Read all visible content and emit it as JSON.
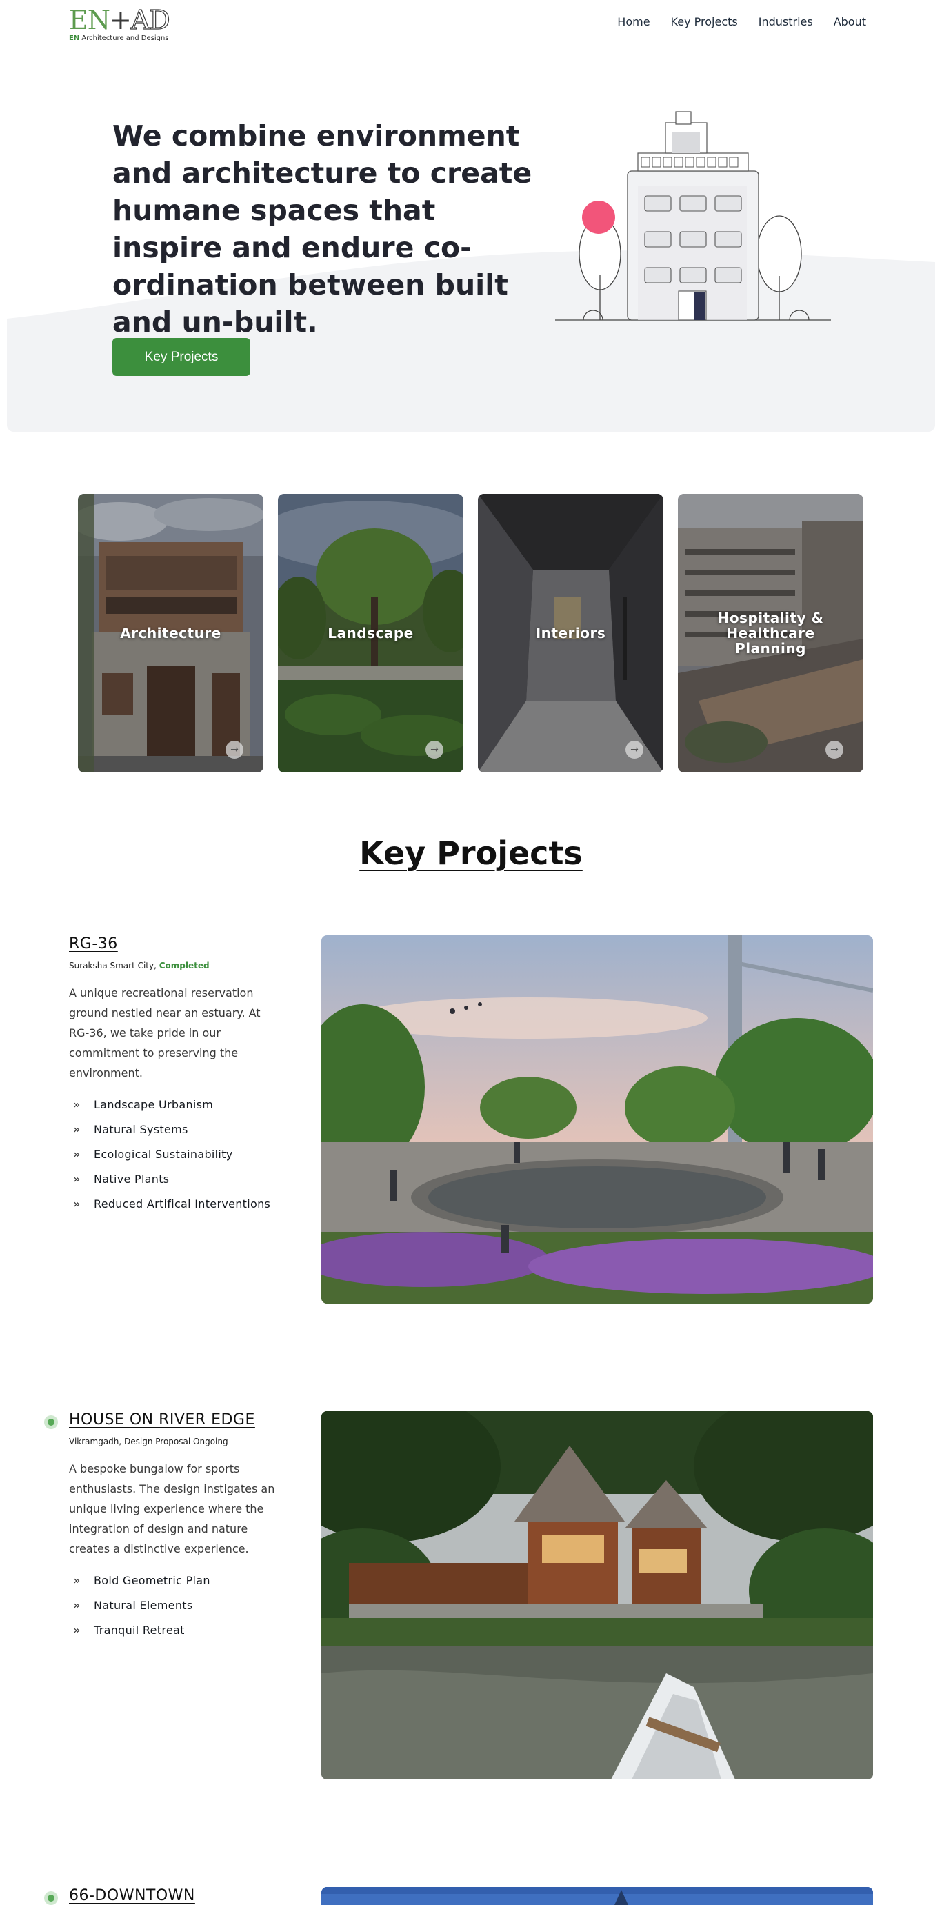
{
  "nav": {
    "logo_mark_en": "EN",
    "logo_mark_plus": "+",
    "logo_mark_ad": "AD",
    "logo_sub_en": "EN",
    "logo_sub_rest": " Architecture and Designs",
    "links": [
      "Home",
      "Key Projects",
      "Industries",
      "About"
    ]
  },
  "hero": {
    "headline": "We combine environment and architecture to create humane spaces that inspire and endure co-ordination between built and un-built.",
    "cta_label": "Key Projects"
  },
  "categories": [
    {
      "label": "Architecture",
      "icon": "arrow-right-icon"
    },
    {
      "label": "Landscape",
      "icon": "arrow-right-icon"
    },
    {
      "label": "Interiors",
      "icon": "arrow-right-icon"
    },
    {
      "label": "Hospitality & Healthcare Planning",
      "icon": "arrow-right-icon"
    }
  ],
  "key_projects": {
    "title": "Key Projects",
    "projects": [
      {
        "name": "RG-36",
        "location": "Suraksha Smart City, ",
        "status": "Completed",
        "description": "A unique recreational reservation ground nestled near an estuary. At RG-36, we take pride in our commitment to preserving the environment.",
        "tags": [
          "Landscape Urbanism",
          "Natural Systems",
          "Ecological Sustainability",
          "Native Plants",
          "Reduced Artifical Interventions"
        ]
      },
      {
        "name": "HOUSE ON RIVER EDGE",
        "location": "Vikramgadh, Design Proposal Ongoing",
        "status": "",
        "description": "A bespoke bungalow for sports enthusiasts. The design instigates an unique living experience where the integration of design and nature creates a distinctive experience.",
        "tags": [
          "Bold Geometric Plan",
          "Natural Elements",
          "Tranquil Retreat"
        ]
      },
      {
        "name": "66-DOWNTOWN",
        "location": "",
        "status": "",
        "description": "",
        "tags": []
      }
    ]
  },
  "colors": {
    "accent_green": "#3c8f3d",
    "heading_dark": "#22242e",
    "hero_grey": "#f2f3f5",
    "pink_sun": "#f2557a"
  }
}
